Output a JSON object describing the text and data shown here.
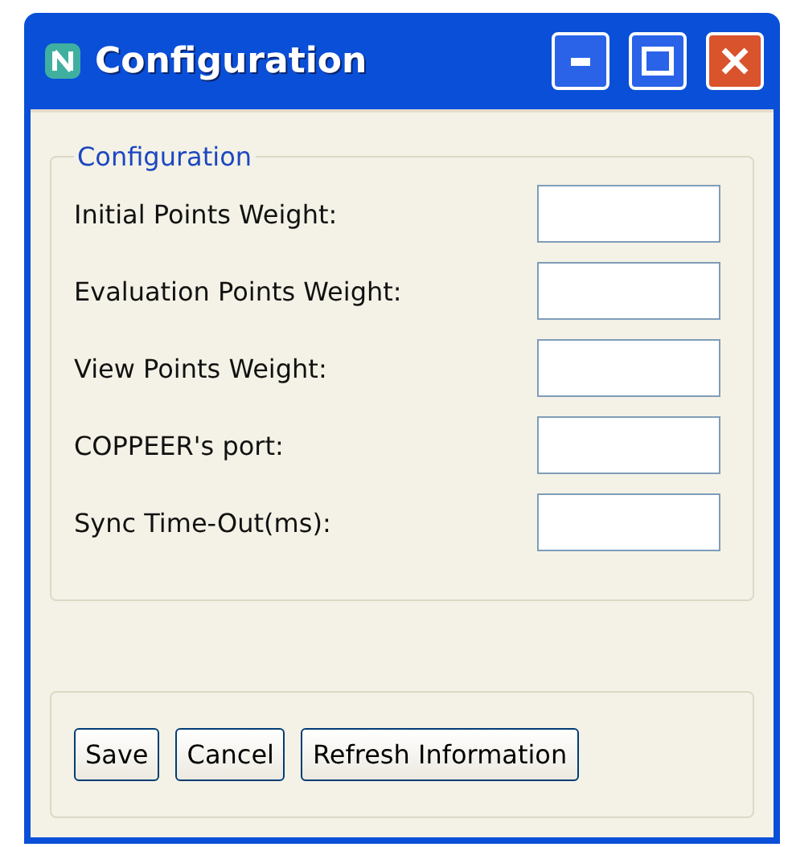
{
  "window": {
    "title": "Configuration"
  },
  "group": {
    "legend": "Configuration"
  },
  "fields": [
    {
      "label": "Initial Points Weight:"
    },
    {
      "label": "Evaluation Points Weight:"
    },
    {
      "label": "View Points Weight:"
    },
    {
      "label": "COPPEER's port:"
    },
    {
      "label": "Sync Time-Out(ms):"
    }
  ],
  "buttons": [
    "Save",
    "Cancel",
    "Refresh Information"
  ]
}
